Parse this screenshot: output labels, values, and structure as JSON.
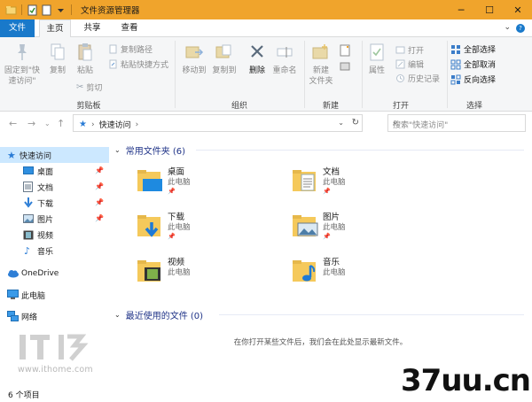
{
  "window": {
    "title": "文件资源管理器",
    "controls": {
      "minimize": "─",
      "maximize": "☐",
      "close": "✕"
    }
  },
  "ribbon_tabs": [
    {
      "label": "文件",
      "state": "file"
    },
    {
      "label": "主页",
      "state": "active"
    },
    {
      "label": "共享",
      "state": "normal"
    },
    {
      "label": "查看",
      "state": "normal"
    }
  ],
  "ribbon": {
    "clipboard": {
      "pin_quick_access": "固定到\"快\n速访问\"",
      "copy": "复制",
      "paste": "粘贴",
      "copy_path": "复制路径",
      "paste_shortcut": "粘贴快捷方式",
      "cut": "剪切",
      "group_label": "剪贴板"
    },
    "organize": {
      "move_to": "移动到",
      "copy_to": "复制到",
      "delete": "删除",
      "rename": "重命名",
      "group_label": "组织"
    },
    "new": {
      "new_folder": "新建\n文件夹",
      "group_label": "新建"
    },
    "open": {
      "properties": "属性",
      "open": "打开",
      "edit": "编辑",
      "history": "历史记录",
      "group_label": "打开"
    },
    "select": {
      "select_all": "全部选择",
      "select_none": "全部取消",
      "invert": "反向选择",
      "group_label": "选择"
    }
  },
  "address": {
    "path": "快速访问",
    "search_placeholder": "搜索\"快速访问\""
  },
  "nav_pane": [
    {
      "label": "快速访问",
      "icon": "star-icon",
      "selected": true
    },
    {
      "label": "桌面",
      "icon": "desktop-icon",
      "pinned": true
    },
    {
      "label": "文档",
      "icon": "document-icon",
      "pinned": true
    },
    {
      "label": "下载",
      "icon": "download-icon",
      "pinned": true
    },
    {
      "label": "图片",
      "icon": "picture-icon",
      "pinned": true
    },
    {
      "label": "视频",
      "icon": "video-icon"
    },
    {
      "label": "音乐",
      "icon": "music-icon"
    },
    {
      "label": "OneDrive",
      "icon": "cloud-icon"
    },
    {
      "label": "此电脑",
      "icon": "computer-icon"
    },
    {
      "label": "网络",
      "icon": "network-icon"
    }
  ],
  "frequent": {
    "heading": "常用文件夹 (6)",
    "folders": [
      {
        "name": "桌面",
        "location": "此电脑",
        "pinned": true
      },
      {
        "name": "文档",
        "location": "此电脑",
        "pinned": true
      },
      {
        "name": "下载",
        "location": "此电脑",
        "pinned": true
      },
      {
        "name": "图片",
        "location": "此电脑",
        "pinned": true
      },
      {
        "name": "视频",
        "location": "此电脑",
        "pinned": false
      },
      {
        "name": "音乐",
        "location": "此电脑",
        "pinned": false
      }
    ]
  },
  "recent": {
    "heading": "最近使用的文件 (0)",
    "empty_message": "在你打开某些文件后，我们会在此处显示最新文件。"
  },
  "status": {
    "item_count": "6 个项目"
  },
  "watermarks": {
    "site_url": "www.ithome.com",
    "brand": "37uu.cn"
  },
  "colors": {
    "titlebar": "#f0a42c",
    "file_tab": "#1979ca",
    "selected_nav": "#cce8ff",
    "section_heading": "#1e3287",
    "folder": "#f5c95b"
  }
}
